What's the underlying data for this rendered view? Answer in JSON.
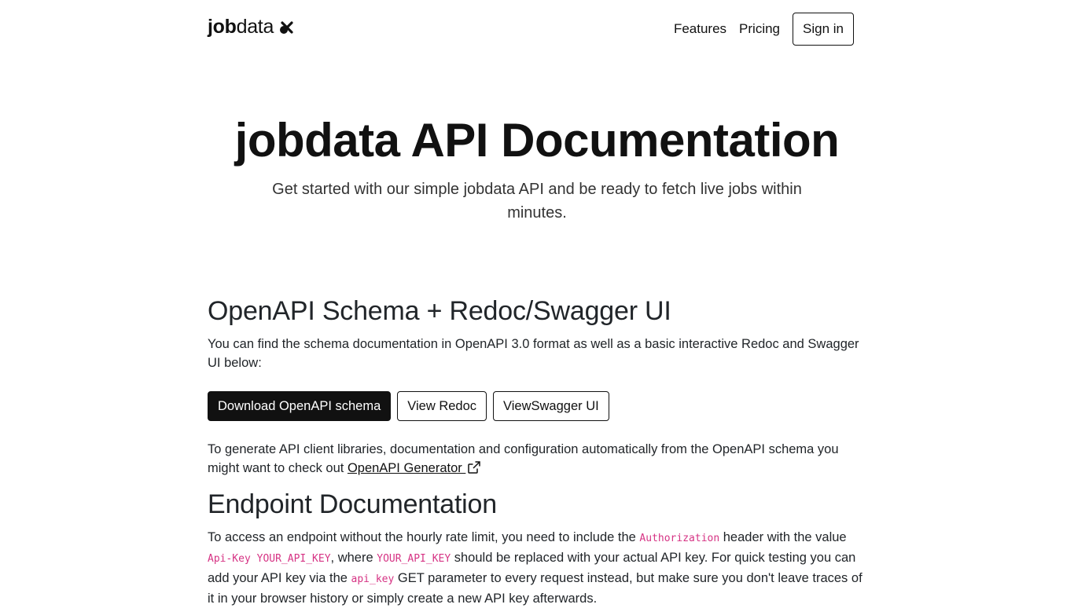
{
  "nav": {
    "brand_bold": "job",
    "brand_light": "data",
    "links": [
      "Features",
      "Pricing"
    ],
    "signin": "Sign in"
  },
  "hero": {
    "title": "jobdata API Documentation",
    "subtitle": "Get started with our simple jobdata API and be ready to fetch live jobs within minutes."
  },
  "openapi": {
    "title": "OpenAPI Schema + Redoc/Swagger UI",
    "description": "You can find the schema documentation in OpenAPI 3.0 format as well as a basic interactive Redoc and Swagger UI below:",
    "buttons": [
      "Download OpenAPI schema",
      "View Redoc",
      "ViewSwagger UI"
    ],
    "generator_text": "To generate API client libraries, documentation and configuration automatically from the OpenAPI schema you might want to check out ",
    "generator_link": "OpenAPI Generator "
  },
  "endpoint": {
    "title": "Endpoint Documentation",
    "p1": "To access an endpoint without the hourly rate limit, you need to include the ",
    "code_auth": "Authorization",
    "p2": " header with the value ",
    "code_value": "Api-Key YOUR_API_KEY",
    "p3": ", where ",
    "code_key": "YOUR_API_KEY",
    "p4": " should be replaced with your actual API key. For quick testing you can add your API key via the ",
    "code_param": "api_key",
    "p5": " GET parameter to every request instead, but make sure you don't leave traces of it in your browser history or simply create a new API key afterwards."
  },
  "colors": {
    "primary": "#111111",
    "code": "#d63384"
  }
}
